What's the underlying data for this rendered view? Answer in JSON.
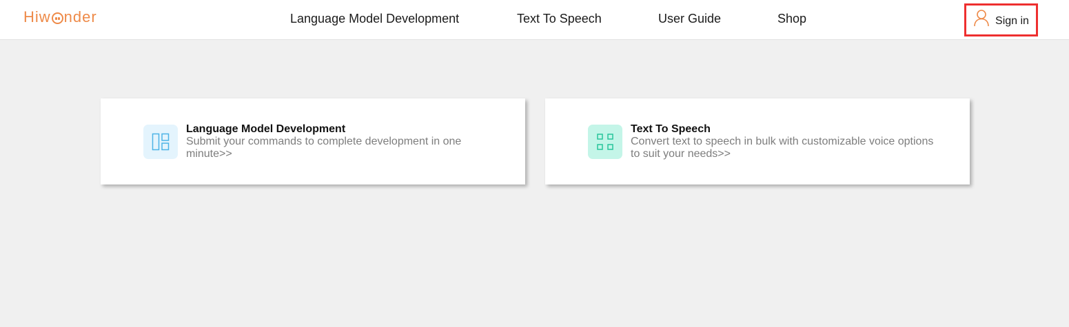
{
  "header": {
    "logo": {
      "prefix": "Hiw",
      "suffix": "nder"
    },
    "nav": [
      {
        "label": "Language Model Development"
      },
      {
        "label": "Text To Speech"
      },
      {
        "label": "User Guide"
      },
      {
        "label": "Shop"
      }
    ],
    "signin": {
      "label": "Sign in",
      "icon": "user-icon"
    }
  },
  "cards": [
    {
      "icon": "layout-panels-icon",
      "title": "Language Model Development",
      "description": "Submit your commands to complete development in one minute>>"
    },
    {
      "icon": "grid-icon",
      "title": "Text To Speech",
      "description": "Convert text to speech in bulk with customizable voice options to suit your needs>>"
    }
  ],
  "colors": {
    "brand": "#ee8a48",
    "highlight_border": "#ee2f2f",
    "page_bg": "#f0f0f0",
    "icon_blue": "#4db3e6",
    "icon_green": "#27c59b"
  }
}
